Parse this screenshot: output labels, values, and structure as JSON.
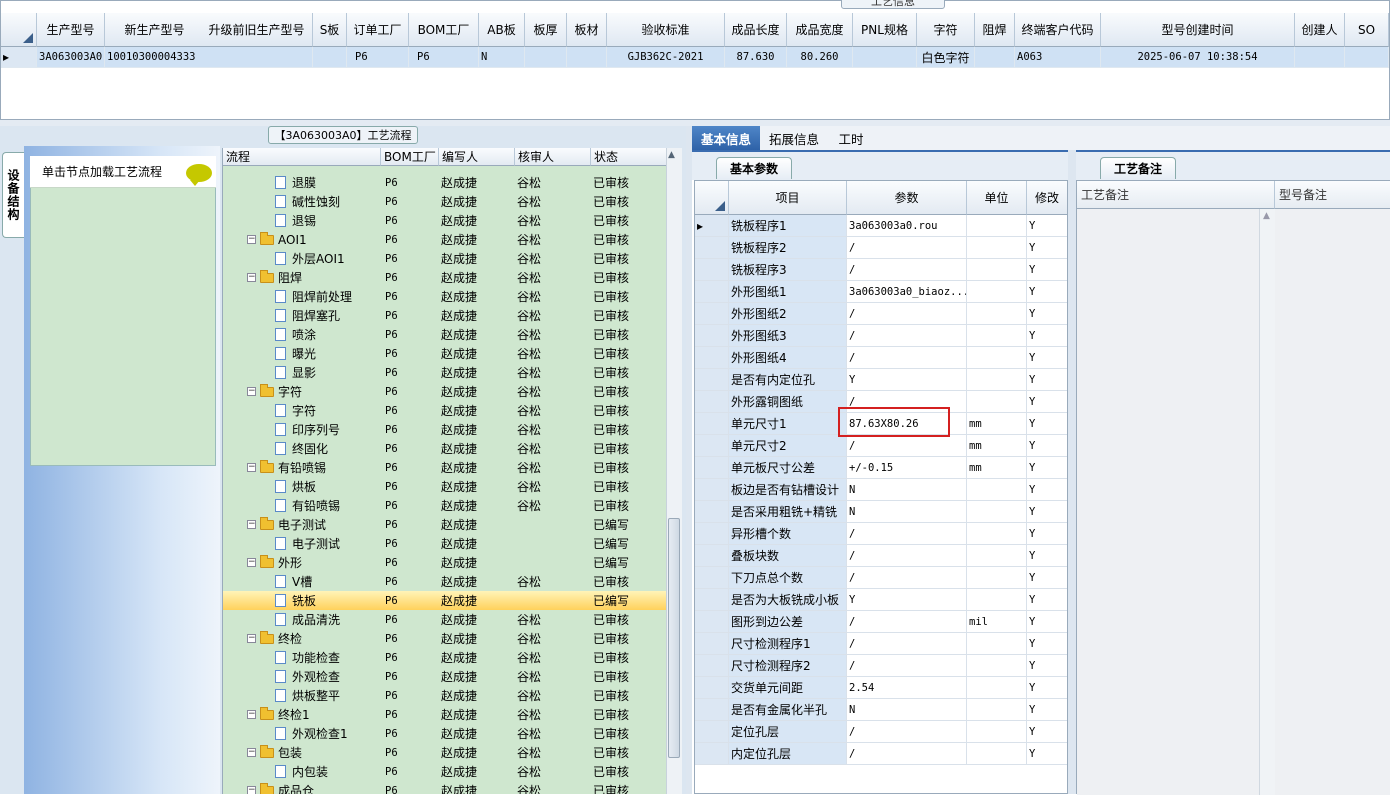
{
  "top": {
    "caption": "工艺信息",
    "headers": [
      "生产型号",
      "新生产型号",
      "升级前旧生产型号",
      "S板",
      "订单工厂",
      "BOM工厂",
      "AB板",
      "板厚",
      "板材",
      "验收标准",
      "成品长度",
      "成品宽度",
      "PNL规格",
      "字符",
      "阻焊",
      "终端客户代码",
      "型号创建时间",
      "创建人",
      "SO"
    ],
    "row": [
      "3A063003A0",
      "10010300004333",
      "",
      "",
      "P6",
      "P6",
      "N",
      "",
      "",
      "GJB362C-2021",
      "87.630",
      "80.260",
      "",
      "白色字符",
      "",
      "A063",
      "2025-06-07 10:38:54",
      "",
      ""
    ]
  },
  "left": {
    "vertical_tab": "设备结构",
    "load_text": "单击节点加载工艺流程",
    "flow_caption": "【3A063003A0】工艺流程",
    "tree_headers": [
      "流程",
      "BOM工厂",
      "编写人",
      "核审人",
      "状态"
    ],
    "rows": [
      {
        "t": "doc",
        "l": 2,
        "name": "退膜",
        "bom": "P6",
        "w": "赵成捷",
        "r": "谷松",
        "s": "已审核"
      },
      {
        "t": "doc",
        "l": 2,
        "name": "碱性蚀刻",
        "bom": "P6",
        "w": "赵成捷",
        "r": "谷松",
        "s": "已审核"
      },
      {
        "t": "doc",
        "l": 2,
        "name": "退锡",
        "bom": "P6",
        "w": "赵成捷",
        "r": "谷松",
        "s": "已审核"
      },
      {
        "t": "folder",
        "l": 1,
        "name": "AOI1",
        "bom": "P6",
        "w": "赵成捷",
        "r": "谷松",
        "s": "已审核"
      },
      {
        "t": "doc",
        "l": 2,
        "name": "外层AOI1",
        "bom": "P6",
        "w": "赵成捷",
        "r": "谷松",
        "s": "已审核"
      },
      {
        "t": "folder",
        "l": 1,
        "name": "阻焊",
        "bom": "P6",
        "w": "赵成捷",
        "r": "谷松",
        "s": "已审核"
      },
      {
        "t": "doc",
        "l": 2,
        "name": "阻焊前处理",
        "bom": "P6",
        "w": "赵成捷",
        "r": "谷松",
        "s": "已审核"
      },
      {
        "t": "doc",
        "l": 2,
        "name": "阻焊塞孔",
        "bom": "P6",
        "w": "赵成捷",
        "r": "谷松",
        "s": "已审核"
      },
      {
        "t": "doc",
        "l": 2,
        "name": "喷涂",
        "bom": "P6",
        "w": "赵成捷",
        "r": "谷松",
        "s": "已审核"
      },
      {
        "t": "doc",
        "l": 2,
        "name": "曝光",
        "bom": "P6",
        "w": "赵成捷",
        "r": "谷松",
        "s": "已审核"
      },
      {
        "t": "doc",
        "l": 2,
        "name": "显影",
        "bom": "P6",
        "w": "赵成捷",
        "r": "谷松",
        "s": "已审核"
      },
      {
        "t": "folder",
        "l": 1,
        "name": "字符",
        "bom": "P6",
        "w": "赵成捷",
        "r": "谷松",
        "s": "已审核"
      },
      {
        "t": "doc",
        "l": 2,
        "name": "字符",
        "bom": "P6",
        "w": "赵成捷",
        "r": "谷松",
        "s": "已审核"
      },
      {
        "t": "doc",
        "l": 2,
        "name": "印序列号",
        "bom": "P6",
        "w": "赵成捷",
        "r": "谷松",
        "s": "已审核"
      },
      {
        "t": "doc",
        "l": 2,
        "name": "终固化",
        "bom": "P6",
        "w": "赵成捷",
        "r": "谷松",
        "s": "已审核"
      },
      {
        "t": "folder",
        "l": 1,
        "name": "有铅喷锡",
        "bom": "P6",
        "w": "赵成捷",
        "r": "谷松",
        "s": "已审核"
      },
      {
        "t": "doc",
        "l": 2,
        "name": "烘板",
        "bom": "P6",
        "w": "赵成捷",
        "r": "谷松",
        "s": "已审核"
      },
      {
        "t": "doc",
        "l": 2,
        "name": "有铅喷锡",
        "bom": "P6",
        "w": "赵成捷",
        "r": "谷松",
        "s": "已审核"
      },
      {
        "t": "folder",
        "l": 1,
        "name": "电子测试",
        "bom": "P6",
        "w": "赵成捷",
        "r": "",
        "s": "已编写"
      },
      {
        "t": "doc",
        "l": 2,
        "name": "电子测试",
        "bom": "P6",
        "w": "赵成捷",
        "r": "",
        "s": "已编写"
      },
      {
        "t": "folder",
        "l": 1,
        "name": "外形",
        "bom": "P6",
        "w": "赵成捷",
        "r": "",
        "s": "已编写"
      },
      {
        "t": "doc",
        "l": 2,
        "name": "V槽",
        "bom": "P6",
        "w": "赵成捷",
        "r": "谷松",
        "s": "已审核"
      },
      {
        "t": "doc",
        "l": 2,
        "name": "铣板",
        "bom": "P6",
        "w": "赵成捷",
        "r": "",
        "s": "已编写",
        "sel": true
      },
      {
        "t": "doc",
        "l": 2,
        "name": "成品清洗",
        "bom": "P6",
        "w": "赵成捷",
        "r": "谷松",
        "s": "已审核"
      },
      {
        "t": "folder",
        "l": 1,
        "name": "终检",
        "bom": "P6",
        "w": "赵成捷",
        "r": "谷松",
        "s": "已审核"
      },
      {
        "t": "doc",
        "l": 2,
        "name": "功能检查",
        "bom": "P6",
        "w": "赵成捷",
        "r": "谷松",
        "s": "已审核"
      },
      {
        "t": "doc",
        "l": 2,
        "name": "外观检查",
        "bom": "P6",
        "w": "赵成捷",
        "r": "谷松",
        "s": "已审核"
      },
      {
        "t": "doc",
        "l": 2,
        "name": "烘板整平",
        "bom": "P6",
        "w": "赵成捷",
        "r": "谷松",
        "s": "已审核"
      },
      {
        "t": "folder",
        "l": 1,
        "name": "终检1",
        "bom": "P6",
        "w": "赵成捷",
        "r": "谷松",
        "s": "已审核"
      },
      {
        "t": "doc",
        "l": 2,
        "name": "外观检查1",
        "bom": "P6",
        "w": "赵成捷",
        "r": "谷松",
        "s": "已审核"
      },
      {
        "t": "folder",
        "l": 1,
        "name": "包装",
        "bom": "P6",
        "w": "赵成捷",
        "r": "谷松",
        "s": "已审核"
      },
      {
        "t": "doc",
        "l": 2,
        "name": "内包装",
        "bom": "P6",
        "w": "赵成捷",
        "r": "谷松",
        "s": "已审核"
      },
      {
        "t": "folder",
        "l": 1,
        "name": "成品仓",
        "bom": "P6",
        "w": "赵成捷",
        "r": "谷松",
        "s": "已审核"
      }
    ]
  },
  "right": {
    "tabs": [
      "基本信息",
      "拓展信息",
      "工时"
    ],
    "sub_caption": "基本参数",
    "memo_caption": "工艺备注",
    "grid_headers": [
      "项目",
      "参数",
      "单位",
      "修改"
    ],
    "params": [
      [
        "铣板程序1",
        "3a063003a0.rou",
        "",
        "Y"
      ],
      [
        "铣板程序2",
        "/",
        "",
        "Y"
      ],
      [
        "铣板程序3",
        "/",
        "",
        "Y"
      ],
      [
        "外形图纸1",
        "3a063003a0_biaoz...",
        "",
        "Y"
      ],
      [
        "外形图纸2",
        "/",
        "",
        "Y"
      ],
      [
        "外形图纸3",
        "/",
        "",
        "Y"
      ],
      [
        "外形图纸4",
        "/",
        "",
        "Y"
      ],
      [
        "是否有内定位孔",
        "Y",
        "",
        "Y"
      ],
      [
        "外形露铜图纸",
        "/",
        "",
        "Y"
      ],
      [
        "单元尺寸1",
        "87.63X80.26",
        "mm",
        "Y"
      ],
      [
        "单元尺寸2",
        "/",
        "mm",
        "Y"
      ],
      [
        "单元板尺寸公差",
        "+/-0.15",
        "mm",
        "Y"
      ],
      [
        "板边是否有钻槽设计",
        "N",
        "",
        "Y"
      ],
      [
        "是否采用粗铣+精铣",
        "N",
        "",
        "Y"
      ],
      [
        "异形槽个数",
        "/",
        "",
        "Y"
      ],
      [
        "叠板块数",
        "/",
        "",
        "Y"
      ],
      [
        "下刀点总个数",
        "/",
        "",
        "Y"
      ],
      [
        "是否为大板铣成小板",
        "Y",
        "",
        "Y"
      ],
      [
        "图形到边公差",
        "/",
        "mil",
        "Y"
      ],
      [
        "尺寸检测程序1",
        "/",
        "",
        "Y"
      ],
      [
        "尺寸检测程序2",
        "/",
        "",
        "Y"
      ],
      [
        "交货单元间距",
        "2.54",
        "",
        "Y"
      ],
      [
        "是否有金属化半孔",
        "N",
        "",
        "Y"
      ],
      [
        "定位孔层",
        "/",
        "",
        "Y"
      ],
      [
        "内定位孔层",
        "/",
        "",
        "Y"
      ]
    ],
    "memo_headers": [
      "工艺备注",
      "型号备注"
    ]
  }
}
